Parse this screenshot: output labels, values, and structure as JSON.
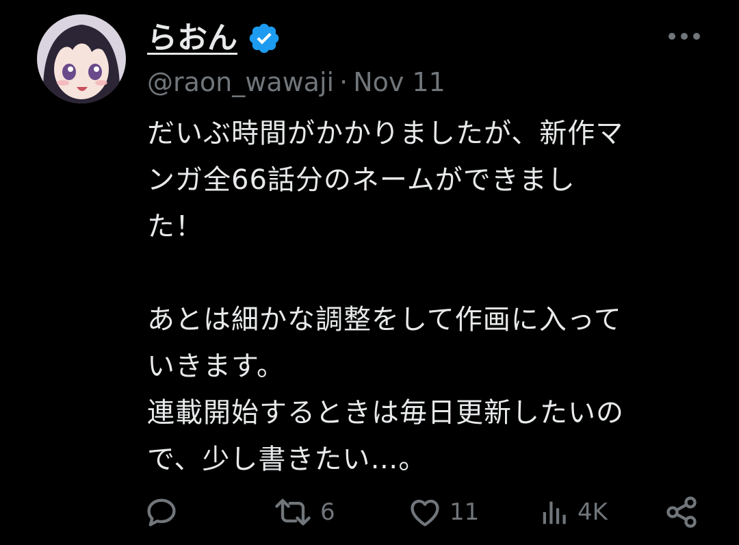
{
  "tweet": {
    "author": {
      "display_name": "らおん",
      "handle": "@raon_wawaji",
      "verified": true,
      "avatar_icon": "avatar-anime-girl"
    },
    "separator": "·",
    "date": "Nov 11",
    "text_lines": [
      "だいぶ時間がかかりましたが、新作マ",
      "ンガ全66話分のネームができまし",
      "た！",
      "",
      "あとは細かな調整をして作画に入って",
      "いきます。",
      "連載開始するときは毎日更新したいの",
      "で、少し書きたい…。"
    ],
    "actions": {
      "reply": {
        "icon": "reply-icon",
        "count": ""
      },
      "retweet": {
        "icon": "retweet-icon",
        "count": "6"
      },
      "like": {
        "icon": "heart-icon",
        "count": "11"
      },
      "views": {
        "icon": "views-icon",
        "count": "4K"
      },
      "share": {
        "icon": "share-icon"
      }
    },
    "more_icon": "more-icon"
  },
  "colors": {
    "background": "#000000",
    "text": "#e7e9ea",
    "muted": "#71767b",
    "verified": "#1d9bf0"
  }
}
